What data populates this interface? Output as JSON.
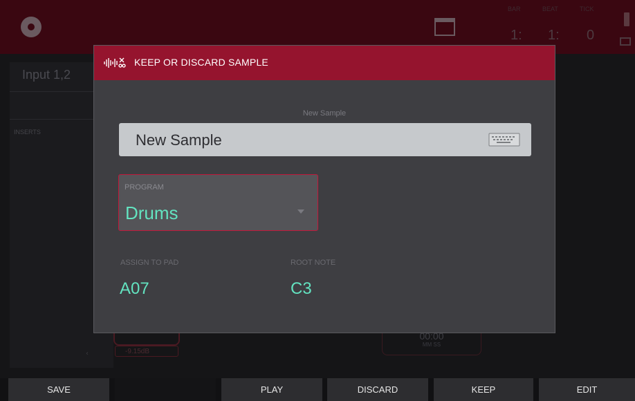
{
  "background": {
    "input_name": "Input 1,2",
    "inserts_label": "INSERTS",
    "counters": [
      "1:",
      "1:",
      "0"
    ],
    "counter_captions": [
      "BAR",
      "BEAT",
      "TICK"
    ],
    "level_readout": "-9.15dB",
    "time_readout": "00:00",
    "time_units": "MM    SS"
  },
  "dialog": {
    "title": "KEEP OR DISCARD SAMPLE",
    "header_icon": "sample-waveform-scissors-icon",
    "name_caption": "New Sample",
    "name_value": "New Sample",
    "keyboard_icon": "keyboard-icon",
    "program": {
      "caption": "PROGRAM",
      "value": "Drums"
    },
    "assign_to_pad": {
      "caption": "ASSIGN TO PAD",
      "value": "A07"
    },
    "root_note": {
      "caption": "ROOT NOTE",
      "value": "C3"
    }
  },
  "function_bar": {
    "buttons": [
      "SAVE",
      "",
      "PLAY",
      "DISCARD",
      "KEEP",
      "EDIT"
    ]
  },
  "colors": {
    "header": "#95142e",
    "accent_value": "#63e3c0",
    "highlight_border": "#c2183a"
  }
}
